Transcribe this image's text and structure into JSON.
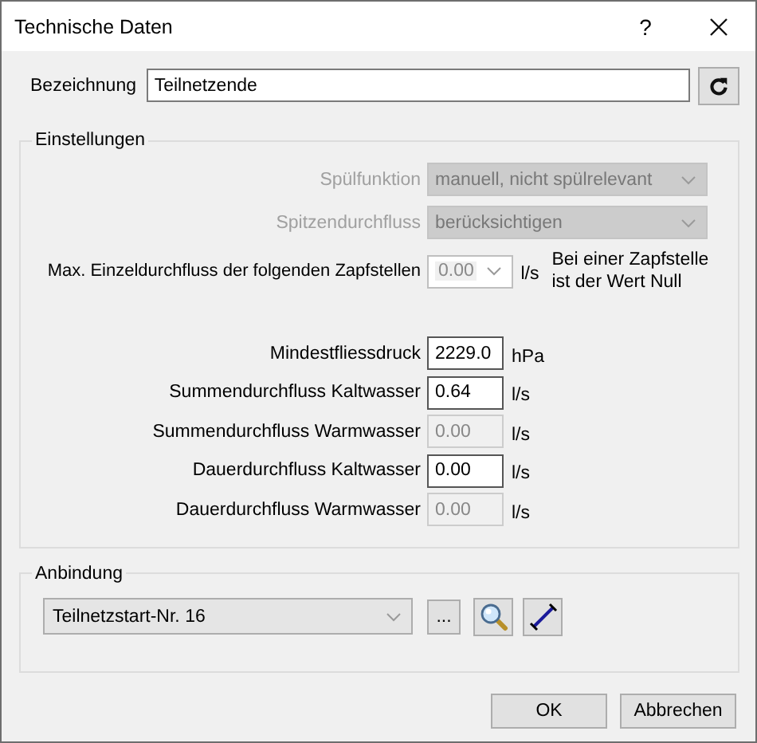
{
  "window": {
    "title": "Technische Daten",
    "help": "?"
  },
  "designation": {
    "label": "Bezeichnung",
    "value": "Teilnetzende"
  },
  "settings": {
    "title": "Einstellungen",
    "selects": [
      {
        "label": "Spülfunktion",
        "value": "manuell, nicht spülrelevant",
        "disabled": true
      },
      {
        "label": "Spitzendurchfluss",
        "value": "berücksichtigen",
        "disabled": true
      }
    ],
    "max_flow": {
      "label": "Max. Einzeldurchfluss der folgenden Zapfstellen",
      "value": "0.00",
      "unit": "l/s",
      "disabled": true,
      "note": "Bei einer Zapfstelle ist der Wert Null"
    },
    "fields": [
      {
        "label": "Mindestfliessdruck",
        "value": "2229.0",
        "unit": "hPa",
        "disabled": false
      },
      {
        "label": "Summendurchfluss Kaltwasser",
        "value": "0.64",
        "unit": "l/s",
        "disabled": false
      },
      {
        "label": "Summendurchfluss Warmwasser",
        "value": "0.00",
        "unit": "l/s",
        "disabled": true
      },
      {
        "label": "Dauerdurchfluss Kaltwasser",
        "value": "0.00",
        "unit": "l/s",
        "disabled": false
      },
      {
        "label": "Dauerdurchfluss Warmwasser",
        "value": "0.00",
        "unit": "l/s",
        "disabled": true
      }
    ]
  },
  "connection": {
    "title": "Anbindung",
    "value": "Teilnetzstart-Nr. 16",
    "more": "..."
  },
  "buttons": [
    {
      "label": "OK"
    },
    {
      "label": "Abbrechen"
    }
  ]
}
